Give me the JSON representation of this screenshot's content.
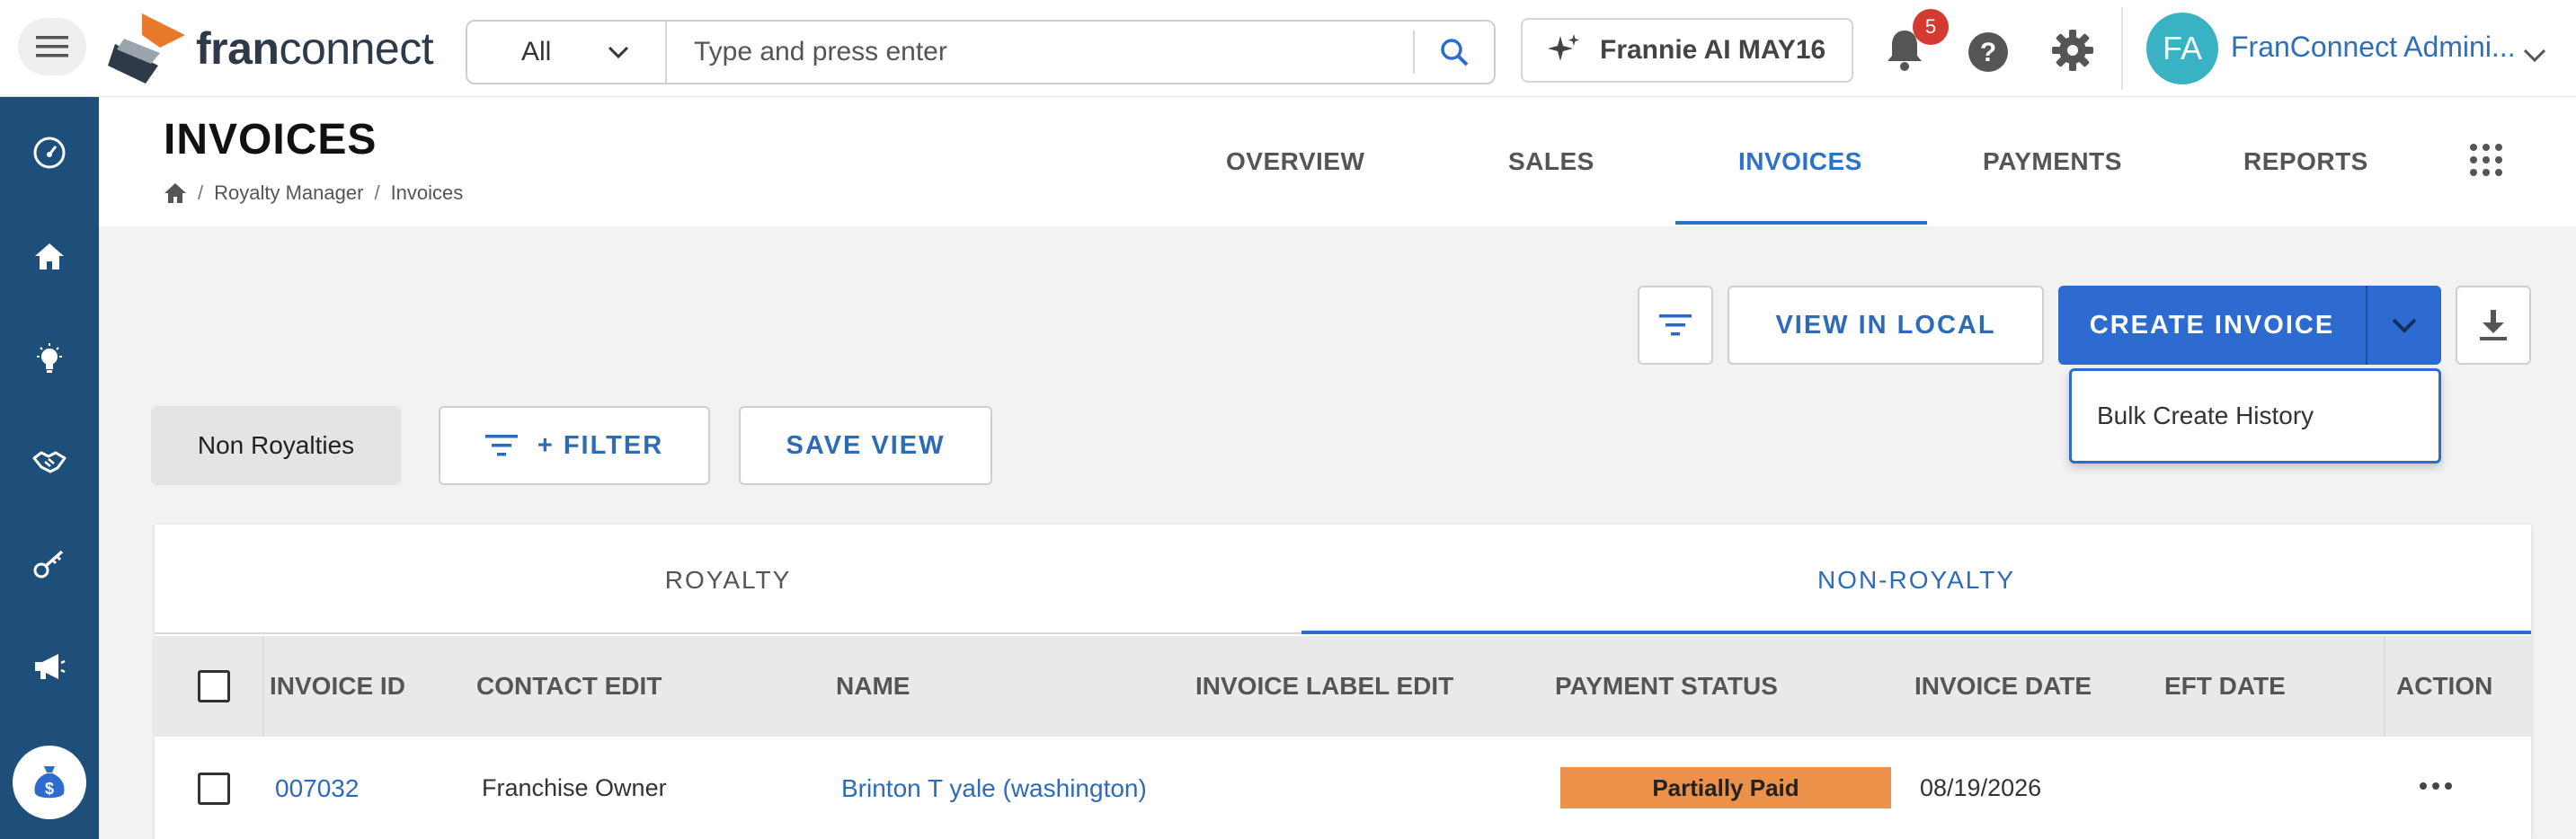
{
  "app": {
    "logo_text_prefix": "fran",
    "logo_text_suffix": "connect"
  },
  "search": {
    "scope": "All",
    "placeholder": "Type and press enter"
  },
  "frannie": {
    "label": "Frannie AI MAY16"
  },
  "notifications": {
    "count": "5"
  },
  "user": {
    "initials": "FA",
    "name": "FranConnect Admini..."
  },
  "header": {
    "title": "INVOICES",
    "breadcrumb": [
      "Royalty Manager",
      "Invoices"
    ],
    "nav": [
      "OVERVIEW",
      "SALES",
      "INVOICES",
      "PAYMENTS",
      "REPORTS"
    ],
    "active_nav": "INVOICES"
  },
  "toolbar": {
    "view_local": "VIEW IN LOCAL",
    "create_invoice": "CREATE INVOICE",
    "dropdown_items": [
      "Bulk Create History"
    ]
  },
  "filters": {
    "active_view": "Non Royalties",
    "filter_label": "+ FILTER",
    "save_view": "SAVE VIEW"
  },
  "tabs": {
    "items": [
      "ROYALTY",
      "NON-ROYALTY"
    ],
    "active": "NON-ROYALTY"
  },
  "table": {
    "columns": [
      "INVOICE ID",
      "CONTACT EDIT",
      "NAME",
      "INVOICE LABEL EDIT",
      "PAYMENT STATUS",
      "INVOICE DATE",
      "EFT DATE",
      "ACTION"
    ],
    "rows": [
      {
        "invoice_id": "007032",
        "contact": "Franchise Owner",
        "name": "Brinton T yale (washington)",
        "invoice_label": "",
        "payment_status": "Partially Paid",
        "invoice_date": "08/19/2026",
        "eft_date": ""
      }
    ]
  },
  "colors": {
    "primary": "#2d6bd1",
    "sidebar": "#1e4f7a",
    "status_partial": "#ec9149",
    "badge": "#d43a2f",
    "avatar": "#39b3c3"
  },
  "icons": {
    "sidebar": [
      "dashboard-icon",
      "home-icon",
      "lightbulb-icon",
      "handshake-icon",
      "key-icon",
      "megaphone-icon",
      "money-bag-icon"
    ]
  }
}
